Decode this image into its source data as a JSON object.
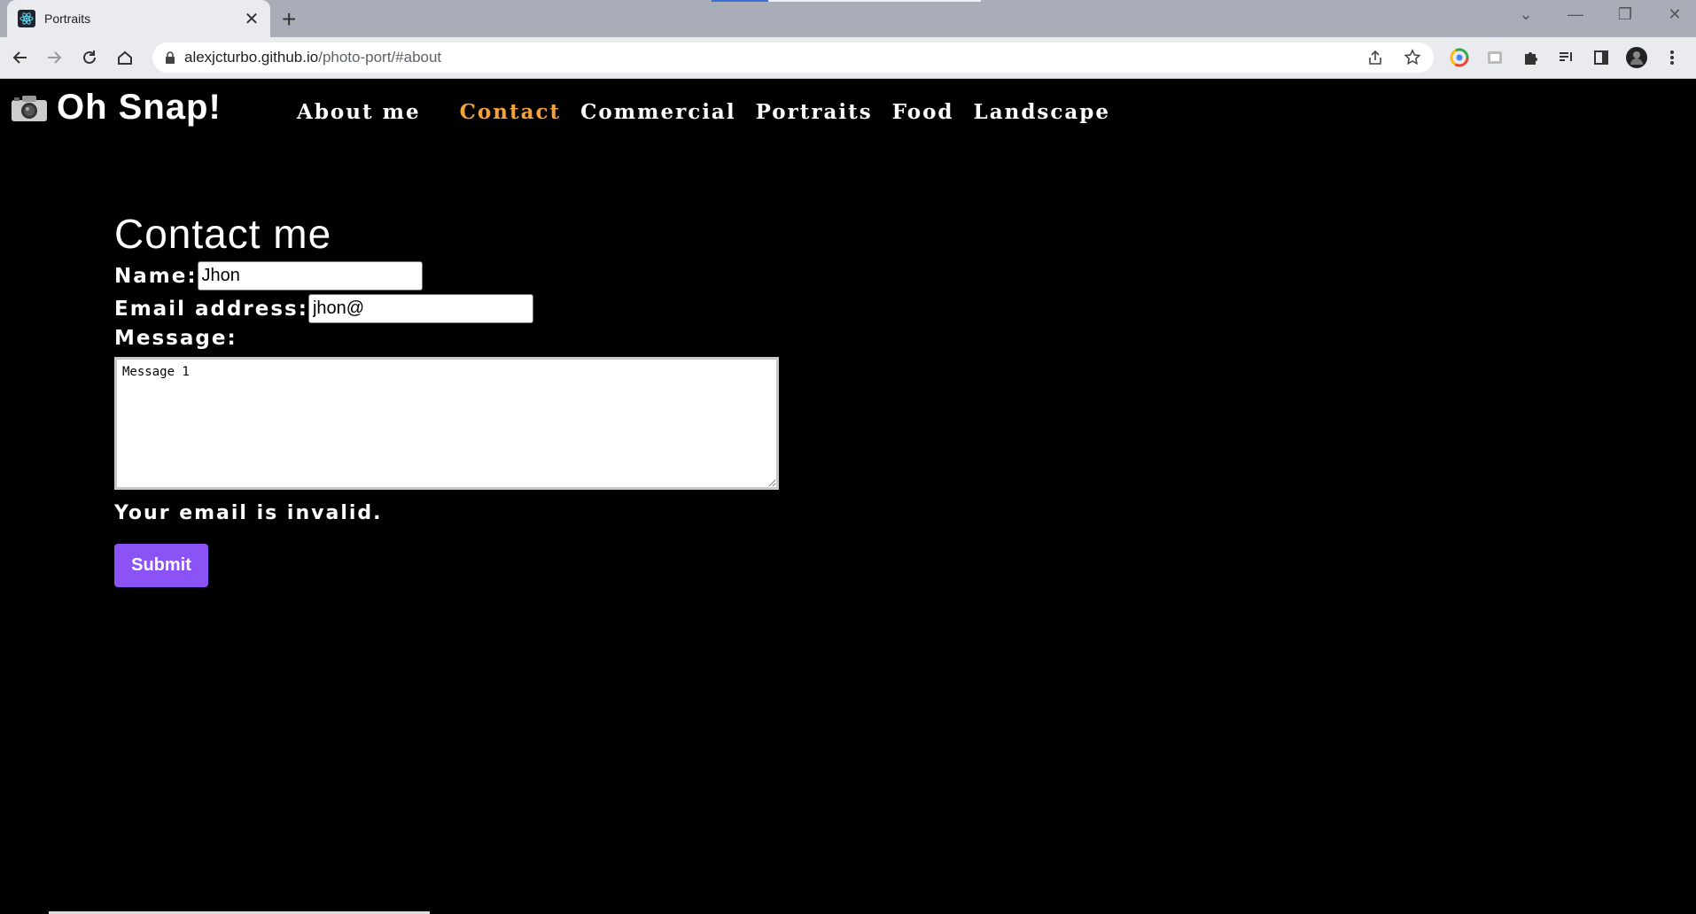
{
  "browser": {
    "tab_title": "Portraits",
    "close_glyph": "✕",
    "newtab_glyph": "+",
    "url_host": "alexjcturbo.github.io",
    "url_path": "/photo-port/#about",
    "window_controls": [
      "⌄",
      "—",
      "❐",
      "✕"
    ]
  },
  "site": {
    "brand_icon": "camera-icon",
    "brand_name": "Oh Snap!",
    "nav": [
      "About me",
      "Contact",
      "Commercial",
      "Portraits",
      "Food",
      "Landscape"
    ],
    "active_nav": "Contact",
    "accent_color": "#f5a23b"
  },
  "contact": {
    "heading": "Contact me",
    "name_label": "Name:",
    "name_value": "Jhon",
    "email_label": "Email address:",
    "email_value": "jhon@",
    "message_label": "Message:",
    "message_value": "Message 1",
    "error_text": "Your email is invalid.",
    "submit_label": "Submit",
    "submit_color": "#8b52f5"
  }
}
